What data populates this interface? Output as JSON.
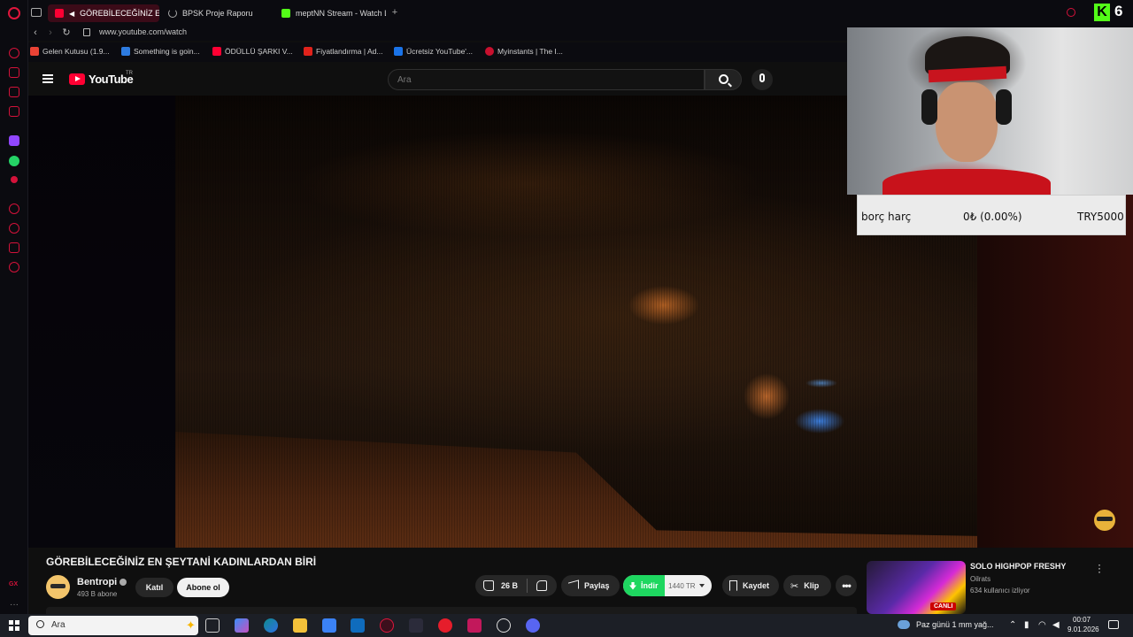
{
  "browser": {
    "tabs": [
      {
        "label": "GÖREBİLECEĞİNİZ EN",
        "active": true
      },
      {
        "label": "BPSK Proje Raporu",
        "active": false
      },
      {
        "label": "meptNN Stream - Watch L",
        "active": false
      }
    ],
    "url": "www.youtube.com/watch",
    "kick_count": "6",
    "bookmarks": [
      {
        "label": "Gelen Kutusu (1.9..."
      },
      {
        "label": "Something is goin..."
      },
      {
        "label": "ÖDÜLLÜ ŞARKI V..."
      },
      {
        "label": "Fiyatlandırma | Ad..."
      },
      {
        "label": "Ücretsiz YouTube'..."
      },
      {
        "label": "Myinstants | The I..."
      }
    ],
    "gx_label": "GX"
  },
  "youtube": {
    "logo_text": "YouTube",
    "region": "TR",
    "search_placeholder": "Ara"
  },
  "overlay": {
    "donation_name": "borç harç",
    "donation_progress": "0₺ (0.00%)",
    "donation_goal": "TRY5000"
  },
  "video_info": {
    "title": "GÖREBİLECEĞİNİZ EN ŞEYTANİ KADINLARDAN BİRİ",
    "channel": "Bentropi",
    "subscribers": "493 B abone",
    "join_label": "Katıl",
    "subscribe_label": "Abone ol",
    "likes": "26 B",
    "share_label": "Paylaş",
    "download_label": "İndir",
    "download_quality": "1440 TR",
    "save_label": "Kaydet",
    "clip_label": "Klip",
    "more_label": "•••"
  },
  "recommendation": {
    "title": "SOLO HIGHPOP FRESHY",
    "channel": "Oilrats",
    "viewers": "634 kullanıcı izliyor",
    "live_label": "CANLI"
  },
  "taskbar": {
    "search_placeholder": "Ara",
    "weather": "Paz günü 1 mm yağ...",
    "time": "00:07",
    "date": "9.01.2026"
  }
}
